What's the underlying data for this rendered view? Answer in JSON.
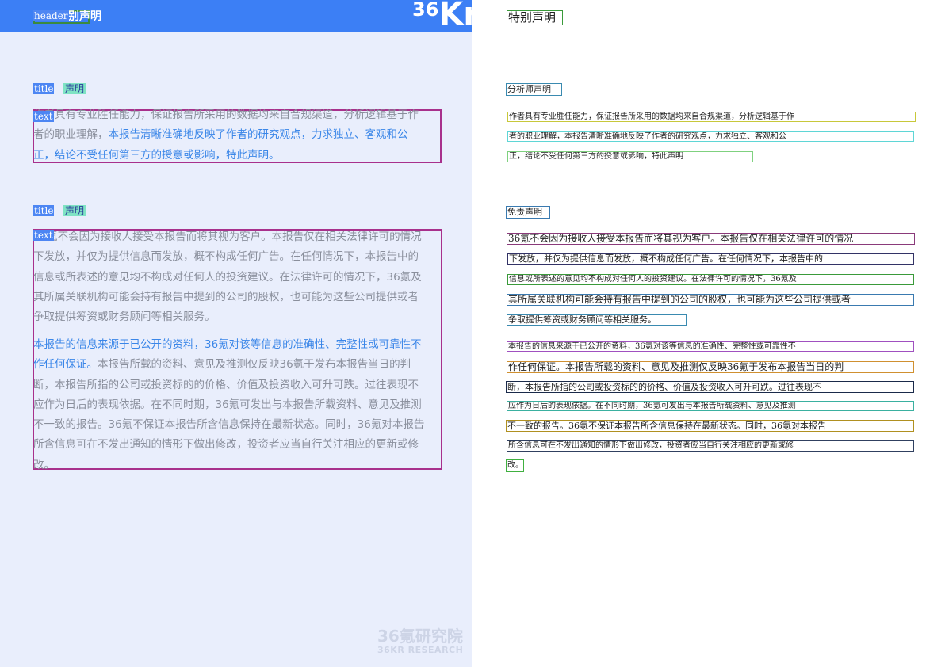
{
  "left_page": {
    "header_tag": "header",
    "header_text": "特别声明",
    "logo": {
      "num": "36",
      "letters": "Kr"
    },
    "section1": {
      "tag": "title",
      "heading": "声明",
      "text_tag": "text",
      "lines": [
        [
          {
            "t": "作者具有专业胜任能力，保证报告所采用的数据均来自合规渠道，分析逻辑基于作",
            "h": false
          }
        ],
        [
          {
            "t": "者的职业理解，",
            "h": false
          },
          {
            "t": "本报告清晰准确地反映了作者的研究观点，力求独立、客观和公",
            "h": true
          }
        ],
        [
          {
            "t": "正，结论不受任何第三方的授意或影响，特此声明。",
            "h": true
          }
        ]
      ]
    },
    "section2": {
      "tag": "title",
      "heading": "声明",
      "text_tag": "text",
      "para1": [
        [
          {
            "t": "36氪不会因为接收人接受本报告而将其视为客户。本报告仅在相关法律许可的情况",
            "h": false
          }
        ],
        [
          {
            "t": "下发放，并仅为提供信息而发放，概不构成任何广告。在任何情况下，本报告中的",
            "h": false
          }
        ],
        [
          {
            "t": "信息或所表述的意见均不构成对任何人的投资建议。在法律许可的情况下，36氪及",
            "h": false
          }
        ],
        [
          {
            "t": "其所属关联机构可能会持有报告中提到的公司的股权，也可能为这些公司提供或者",
            "h": false
          }
        ],
        [
          {
            "t": "争取提供筹资或财务顾问等相关服务。",
            "h": false
          }
        ]
      ],
      "para2": [
        [
          {
            "t": "本报告的信息来源于已公开的资料，36氪对该等信息的准确性、完整性或可靠性不",
            "h": true
          }
        ],
        [
          {
            "t": "作任何保证。",
            "h": true
          },
          {
            "t": "本报告所载的资料、意见及推测仅反映36氪于发布本报告当日的判",
            "h": false
          }
        ],
        [
          {
            "t": "断，本报告所指的公司或投资标的的价格、价值及投资收入可升可跌。过往表现不",
            "h": false
          }
        ],
        [
          {
            "t": "应作为日后的表现依据。在不同时期，36氪可发出与本报告所载资料、意见及推测",
            "h": false
          }
        ],
        [
          {
            "t": "不一致的报告。36氪不保证本报告所含信息保持在最新状态。同时，36氪对本报告",
            "h": false
          }
        ],
        [
          {
            "t": "所含信息可在不发出通知的情形下做出修改，投资者应当自行关注相应的更新或修",
            "h": false
          }
        ],
        [
          {
            "t": "改。",
            "h": false
          }
        ]
      ]
    },
    "watermark": {
      "line1": "36氪研究院",
      "line2": "36KR  RESEARCH"
    }
  },
  "right_page": {
    "title": "特别声明",
    "analyst_heading": "分析师声明",
    "analyst_lines": [
      "作者具有专业胜任能力，保证报告所采用的数据均来自合规渠道，分析逻辑基于作",
      "者的职业理解，本报告清晰准确地反映了作者的研究观点，力求独立、客观和公",
      "正，结论不受任何第三方的授意或影响，特此声明"
    ],
    "disclaimer_heading": "免责声明",
    "disclaimer_lines": [
      "36氪不会因为接收人接受本报告而将其视为客户。本报告仅在相关法律许可的情况",
      "下发放，并仅为提供信息而发放，概不构成任何广告。在任何情况下，本报告中的",
      "信息或所表述的意见均不构成对任何人的投资建议。在法律许可的情况下，36氪及",
      "其所属关联机构可能会持有报告中提到的公司的股权，也可能为这些公司提供或者",
      "争取提供筹资或财务顾问等相关服务。",
      "本报告的信息来源于已公开的资料，36氪对该等信息的准确性、完整性或可靠性不",
      "作任何保证。本报告所载的资料、意见及推测仅反映36氪于发布本报告当日的判",
      "断，本报告所指的公司或投资标的的价格、价值及投资收入可升可跌。过往表现不",
      "应作为日后的表现依据。在不同时期，36氪可发出与本报告所载资料、意见及推测",
      "不一致的报告。36氪不保证本报告所含信息保持在最新状态。同时，36氪对本报告",
      "所含信息可在不发出通知的情形下做出修改，投资者应当自行关注相应的更新或修",
      "改。"
    ],
    "box_colors": [
      "#c8c83a",
      "#5fd6d6",
      "#7fd17f",
      "#8a3a7a",
      "#333366",
      "#3a9a3a",
      "#3a7ab0",
      "#3a8ab0",
      "#a050c0",
      "#d09030",
      "#1a2a4a",
      "#3ab0a0",
      "#b09020",
      "#304060",
      "#40b040"
    ]
  }
}
